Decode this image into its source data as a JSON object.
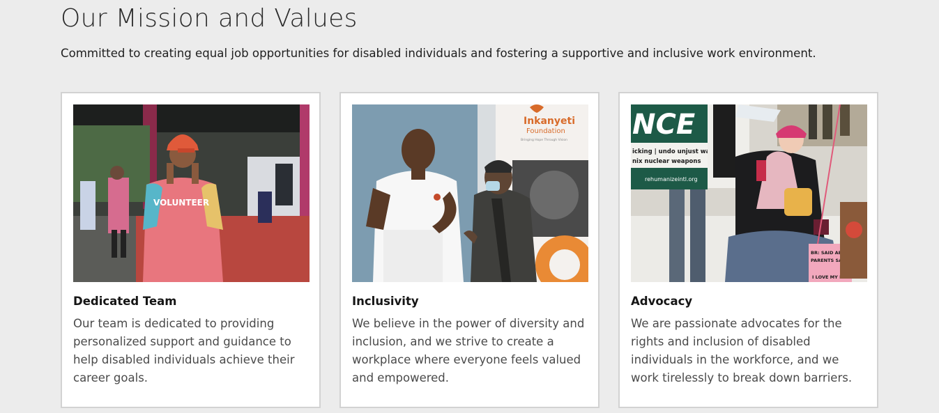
{
  "section": {
    "title": "Our Mission and Values",
    "subtitle": "Committed to creating equal job opportunities for disabled individuals and fostering a supportive and inclusive work environment."
  },
  "cards": [
    {
      "title": "Dedicated Team",
      "text": "Our team is dedicated to providing personalized support and guidance to help disabled individuals achieve their career goals.",
      "image": {
        "subject": "volunteer-photo",
        "shirt_text": "VOLUNTEER"
      }
    },
    {
      "title": "Inclusivity",
      "text": "We believe in the power of diversity and inclusion, and we strive to create a workplace where everyone feels valued and empowered.",
      "image": {
        "subject": "foundation-event-photo",
        "banner_title": "Inkanyeti",
        "banner_subtitle": "Foundation",
        "banner_tagline": "Bringing Hope Through Vision"
      }
    },
    {
      "title": "Advocacy",
      "text": "We are passionate advocates for the rights and inclusion of disabled individuals in the workforce, and we work tirelessly to break down barriers.",
      "image": {
        "subject": "rally-photo",
        "banner_big": "NCE",
        "banner_line1": "icking | undo unjust war",
        "banner_line2": "nix nuclear weapons",
        "banner_url": "rehumanizeintl.org",
        "sign_line1": "BR: SAID ABORT",
        "sign_line2": "PARENTS SAID NO",
        "sign_line3": "I LOVE MY LIFE"
      }
    }
  ]
}
